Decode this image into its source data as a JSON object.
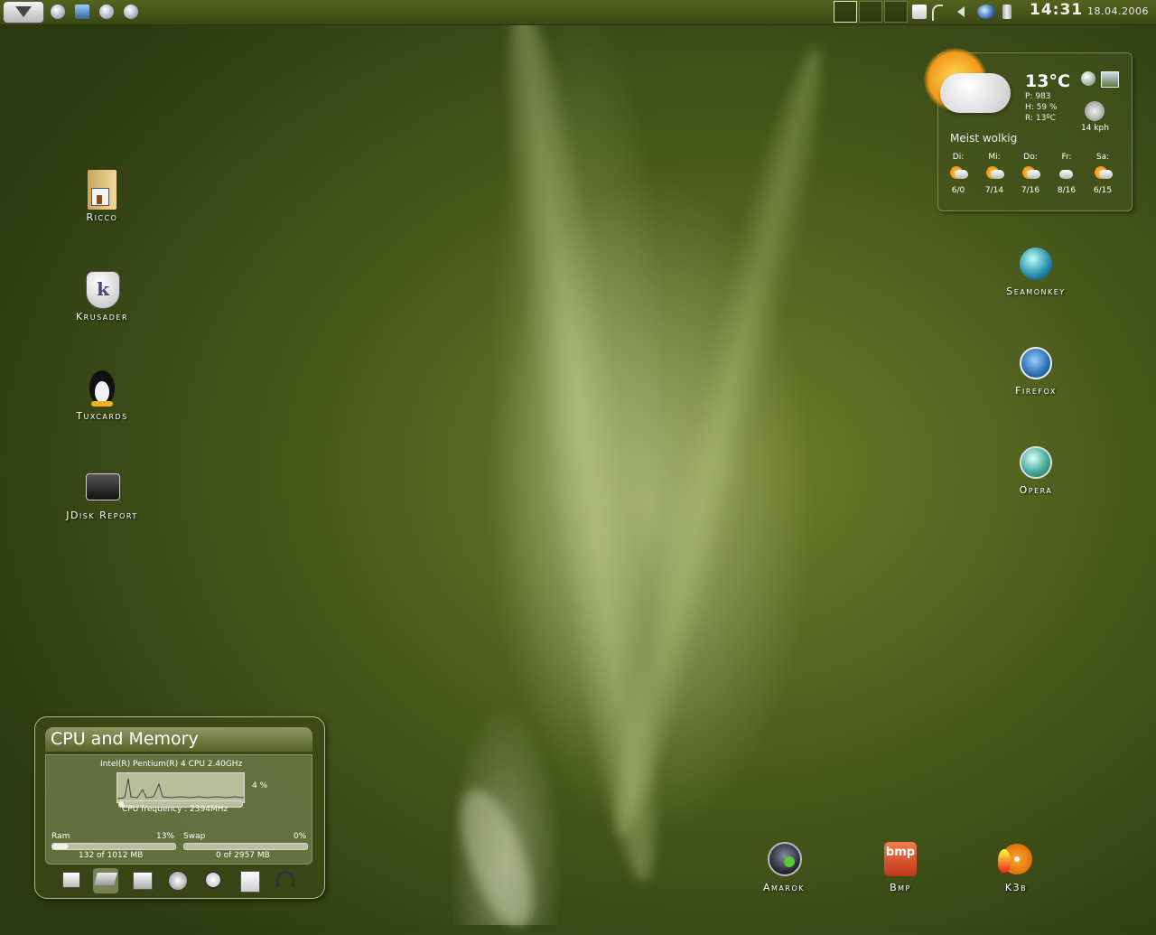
{
  "panel": {
    "clock": "14:31",
    "date": "18.04.2006"
  },
  "desktop_left": [
    {
      "label": "Ricco",
      "icon": "home-folder-icon"
    },
    {
      "label": "Krusader",
      "icon": "krusader-shield-icon"
    },
    {
      "label": "Tuxcards",
      "icon": "penguin-icon"
    },
    {
      "label": "JDisk Report",
      "icon": "hard-disk-icon"
    }
  ],
  "desktop_right": [
    {
      "label": "Seamonkey",
      "icon": "globe-icon"
    },
    {
      "label": "Firefox",
      "icon": "firefox-icon"
    },
    {
      "label": "Opera",
      "icon": "globe-icon"
    }
  ],
  "desktop_bottom": [
    {
      "label": "Amarok",
      "icon": "amarok-icon"
    },
    {
      "label": "Bmp",
      "icon": "bmp-icon"
    },
    {
      "label": "K3b",
      "icon": "k3b-disc-icon"
    }
  ],
  "weather": {
    "temp": "13°C",
    "pressure": "P: 983",
    "humidity": "H: 59 %",
    "real": "R: 13ºC",
    "wind": "14 kph",
    "description": "Meist wolkig",
    "forecast": [
      {
        "day": "Di:",
        "range": "6/0"
      },
      {
        "day": "Mi:",
        "range": "7/14"
      },
      {
        "day": "Do:",
        "range": "7/16"
      },
      {
        "day": "Fr:",
        "range": "8/16"
      },
      {
        "day": "Sa:",
        "range": "6/15"
      }
    ]
  },
  "cpu_widget": {
    "title": "CPU and Memory",
    "cpu_name": "Intel(R) Pentium(R) 4 CPU 2.40GHz",
    "cpu_usage": "4 %",
    "cpu_frequency": "CPU frequency : 2394MHz",
    "ram_label": "Ram",
    "ram_percent": "13%",
    "ram_fraction": 0.13,
    "ram_detail": "132 of 1012 MB",
    "swap_label": "Swap",
    "swap_percent": "0%",
    "swap_fraction": 0,
    "swap_detail": "0 of 2957 MB",
    "tabs": [
      "monitor-icon",
      "cpu-chip-icon",
      "disk-icon",
      "network-icon",
      "alarm-clock-icon",
      "calendar-icon",
      "headset-icon"
    ]
  }
}
